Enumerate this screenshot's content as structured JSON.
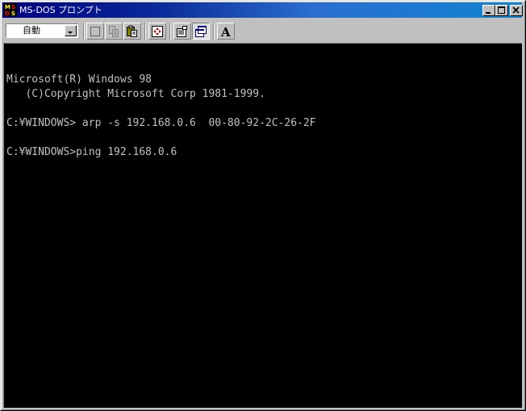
{
  "window": {
    "title": "MS-DOS プロンプト",
    "app_icon": "msdos-icon",
    "controls": {
      "minimize": "minimize-icon",
      "maximize": "maximize-icon",
      "close": "close-icon"
    }
  },
  "toolbar": {
    "font_size": {
      "value": "自動"
    },
    "tools": [
      {
        "name": "mark-button",
        "icon": "mark-icon"
      },
      {
        "name": "copy-button",
        "icon": "copy-icon"
      },
      {
        "name": "paste-button",
        "icon": "paste-icon"
      },
      {
        "name": "fullscreen-button",
        "icon": "fullscreen-icon"
      },
      {
        "name": "properties-button",
        "icon": "properties-icon"
      },
      {
        "name": "background-button",
        "icon": "background-icon"
      },
      {
        "name": "font-button",
        "icon": "font-icon",
        "label": "A"
      }
    ]
  },
  "console": {
    "lines": [
      "",
      "Microsoft(R) Windows 98",
      "   (C)Copyright Microsoft Corp 1981-1999.",
      "",
      "C:¥WINDOWS> arp -s 192.168.0.6  00-80-92-2C-26-2F",
      "",
      "C:¥WINDOWS>ping 192.168.0.6"
    ],
    "text_color": "#c0c0c0",
    "background_color": "#000000"
  },
  "colors": {
    "title_active_start": "#000080",
    "title_active_end": "#1084d0",
    "face": "#c0c0c0"
  }
}
